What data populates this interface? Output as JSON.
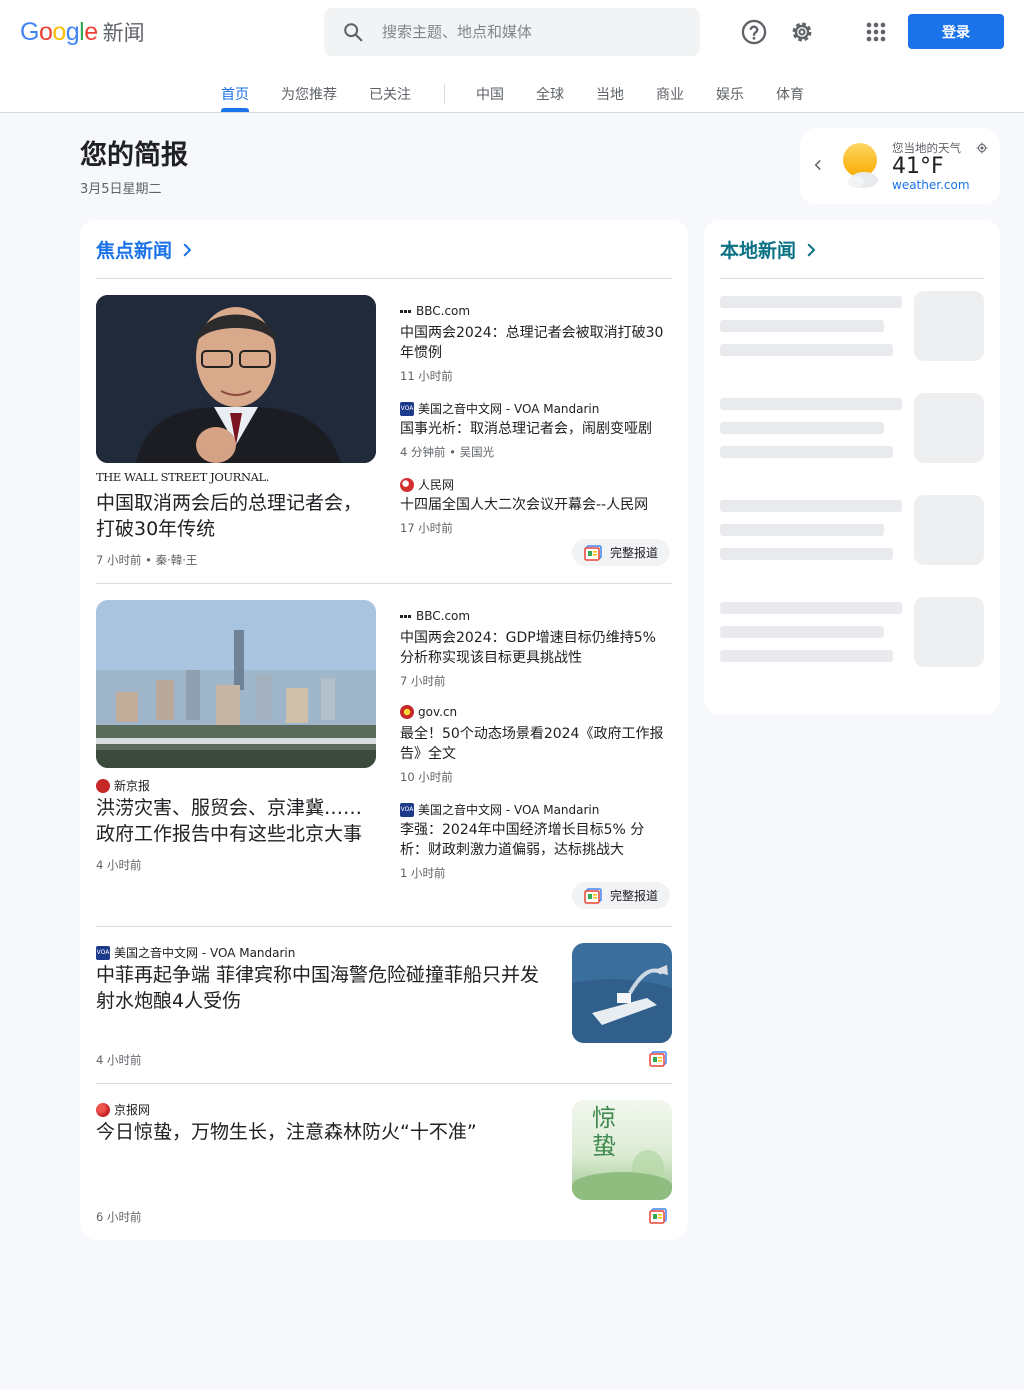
{
  "header": {
    "logo_google": "Google",
    "logo_news": "新闻",
    "search_placeholder": "搜索主题、地点和媒体",
    "login_label": "登录"
  },
  "tabs": [
    {
      "label": "首页",
      "active": true
    },
    {
      "label": "为您推荐"
    },
    {
      "label": "已关注"
    },
    {
      "label": "中国"
    },
    {
      "label": "全球"
    },
    {
      "label": "当地"
    },
    {
      "label": "商业"
    },
    {
      "label": "娱乐"
    },
    {
      "label": "体育"
    }
  ],
  "briefing": {
    "title": "您的简报",
    "date": "3月5日星期二"
  },
  "weather": {
    "label": "您当地的天气",
    "temp": "41°F",
    "source": "weather.com"
  },
  "top_stories": {
    "heading": "焦点新闻",
    "full_coverage_label": "完整报道",
    "cluster1": {
      "main": {
        "source": "THE WALL STREET JOURNAL.",
        "headline": "中国取消两会后的总理记者会，打破30年传统",
        "time": "7 小时前",
        "author": "秦·韓·王"
      },
      "related": [
        {
          "source": "BBC.com",
          "headline": "中国两会2024：总理记者会被取消打破30年惯例",
          "meta": "11 小时前"
        },
        {
          "source": "美国之音中文网 - VOA Mandarin",
          "headline": "国事光析：取消总理记者会，闹剧变哑剧",
          "meta": "4 分钟前 • 吴国光"
        },
        {
          "source": "人民网",
          "headline": "十四届全国人大二次会议开幕会--人民网",
          "meta": "17 小时前"
        }
      ]
    },
    "cluster2": {
      "main": {
        "source": "新京报",
        "headline": "洪涝灾害、服贸会、京津冀……政府工作报告中有这些北京大事",
        "time": "4 小时前"
      },
      "related": [
        {
          "source": "BBC.com",
          "headline": "中国两会2024：GDP增速目标仍维持5% 分析称实现该目标更具挑战性",
          "meta": "7 小时前"
        },
        {
          "source": "gov.cn",
          "headline": "最全！50个动态场景看2024《政府工作报告》全文",
          "meta": "10 小时前"
        },
        {
          "source": "美国之音中文网 - VOA Mandarin",
          "headline": "李强：2024年中国经济增长目标5% 分析：财政刺激力道偏弱，达标挑战大",
          "meta": "1 小时前"
        }
      ]
    },
    "story3": {
      "source": "美国之音中文网 - VOA Mandarin",
      "headline": "中菲再起争端 菲律宾称中国海警危险碰撞菲船只并发射水炮酿4人受伤",
      "time": "4 小时前"
    },
    "story4": {
      "source": "京报网",
      "headline": "今日惊蛰，万物生长，注意森林防火“十不准”",
      "time": "6 小时前",
      "image_text": "惊蛰"
    }
  },
  "local": {
    "heading": "本地新闻"
  },
  "colors": {
    "accent": "#1a73e8",
    "local_accent": "#0b7285"
  }
}
